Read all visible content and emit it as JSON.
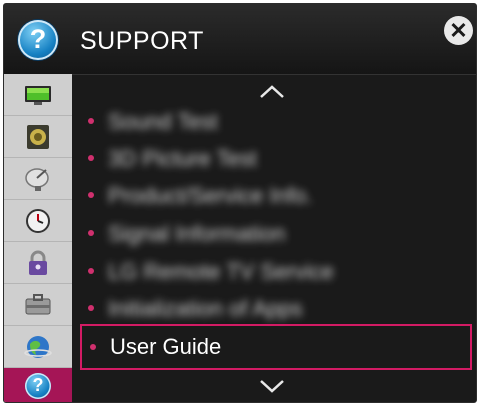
{
  "header": {
    "title": "SUPPORT",
    "close_symbol": "✕",
    "help_symbol": "?"
  },
  "sidebar": {
    "items": [
      {
        "icon": "tv-screen-icon"
      },
      {
        "icon": "speaker-icon"
      },
      {
        "icon": "satellite-dish-icon"
      },
      {
        "icon": "clock-icon"
      },
      {
        "icon": "padlock-icon"
      },
      {
        "icon": "toolbox-icon"
      },
      {
        "icon": "globe-icon"
      },
      {
        "icon": "help-icon",
        "active": true,
        "symbol": "?"
      }
    ]
  },
  "menu": {
    "items": [
      {
        "label": "Sound Test",
        "blurred": true
      },
      {
        "label": "3D Picture Test",
        "blurred": true
      },
      {
        "label": "Product/Service Info.",
        "blurred": true
      },
      {
        "label": "Signal Information",
        "blurred": true
      },
      {
        "label": "LG Remote TV Service",
        "blurred": true
      },
      {
        "label": "Initialization of Apps",
        "blurred": true
      },
      {
        "label": "User Guide",
        "selected": true
      }
    ]
  },
  "colors": {
    "accent": "#d31b64",
    "sidebar_active": "#a51556",
    "panel_bg": "#1a1a1a",
    "sidebar_bg": "#cfcfcf"
  }
}
